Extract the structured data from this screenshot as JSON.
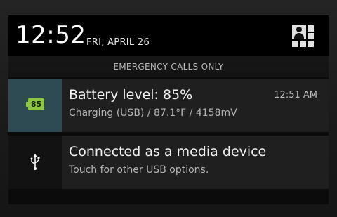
{
  "header": {
    "time": "12:52",
    "date": "FRI, APRIL 26",
    "settings_icon": "quick-settings-icon"
  },
  "status": {
    "emergency_text": "EMERGENCY CALLS ONLY"
  },
  "notifications": [
    {
      "icon": "battery-icon",
      "icon_text": "85",
      "title": "Battery level: 85%",
      "subtitle": "Charging (USB) / 87.1°F / 4158mV",
      "time": "12:51 AM"
    },
    {
      "icon": "usb-icon",
      "title": "Connected as a media device",
      "subtitle": "Touch for other USB options."
    }
  ],
  "colors": {
    "battery_accent": "#8dc63f",
    "battery_tile": "#2e4a52"
  }
}
